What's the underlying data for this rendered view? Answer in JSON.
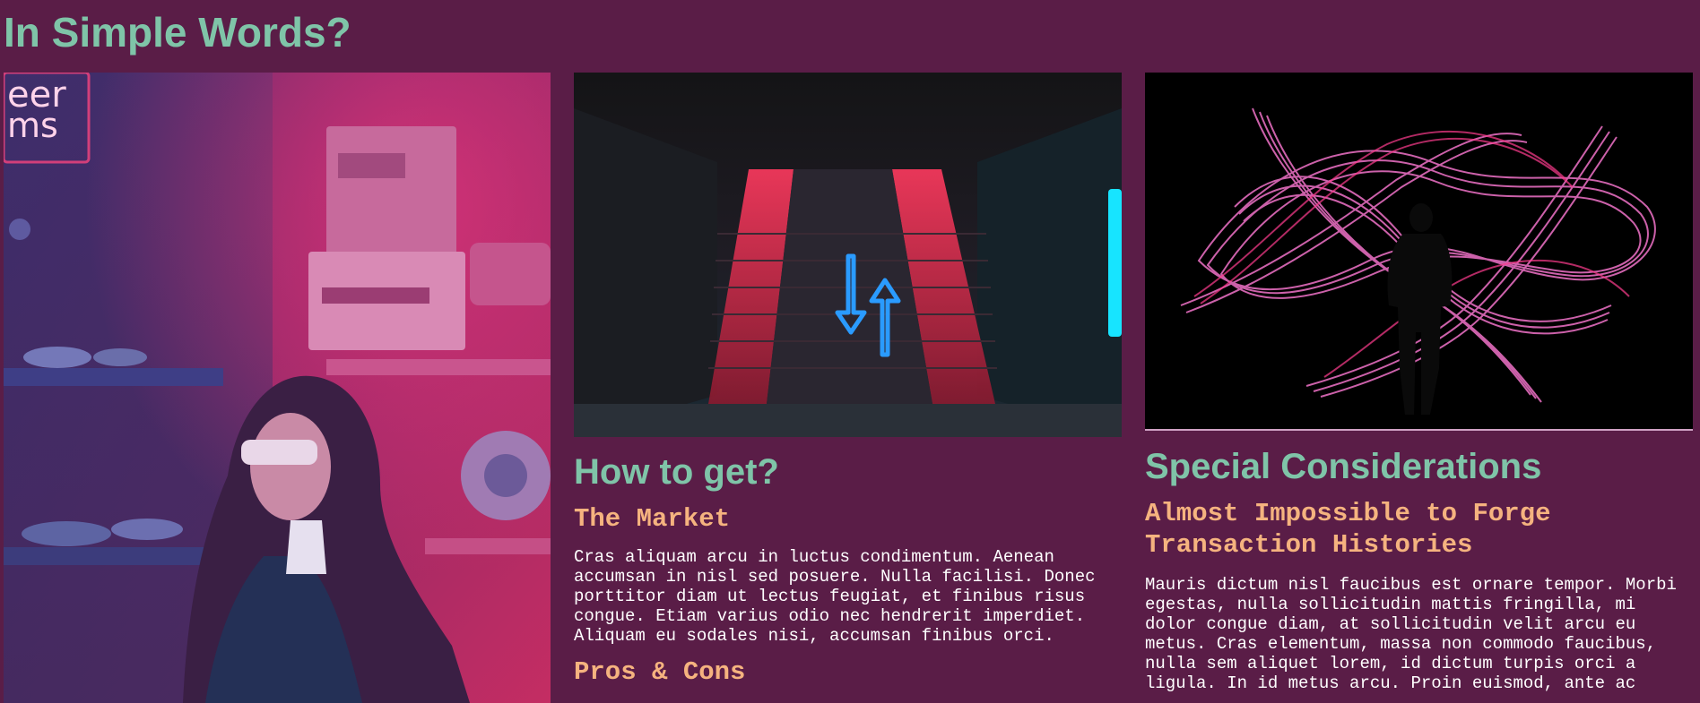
{
  "page": {
    "title": "In Simple Words?"
  },
  "images": {
    "left": "Woman with sunglasses in neon-lit room",
    "middle": "Staircase with neon up and down arrows",
    "right": "Silhouette in front of pink light trails"
  },
  "colors": {
    "background": "#5a1d47",
    "heading": "#7fc4a8",
    "subheading": "#f5b37f",
    "body_text": "#ffffff"
  },
  "sections": {
    "how_to_get": {
      "heading": "How to get?",
      "market_title": "The Market",
      "market_text": "Cras aliquam arcu in luctus condimentum. Aenean accumsan in nisl sed posuere. Nulla facilisi. Donec porttitor diam ut lectus feugiat, et finibus risus congue. Etiam varius odio nec hendrerit imperdiet. Aliquam eu sodales nisi, accumsan finibus orci.",
      "pros_title": "Pros & Cons"
    },
    "special": {
      "heading": "Special Considerations",
      "forge_title": "Almost Impossible to Forge Transaction Histories",
      "forge_text": "Mauris dictum nisl faucibus est ornare tempor. Morbi egestas, nulla sollicitudin mattis fringilla, mi dolor congue diam, at sollicitudin velit arcu eu metus. Cras elementum, massa non commodo faucibus, nulla sem aliquet lorem, id dictum turpis orci a ligula. In id metus arcu. Proin euismod, ante ac"
    }
  }
}
